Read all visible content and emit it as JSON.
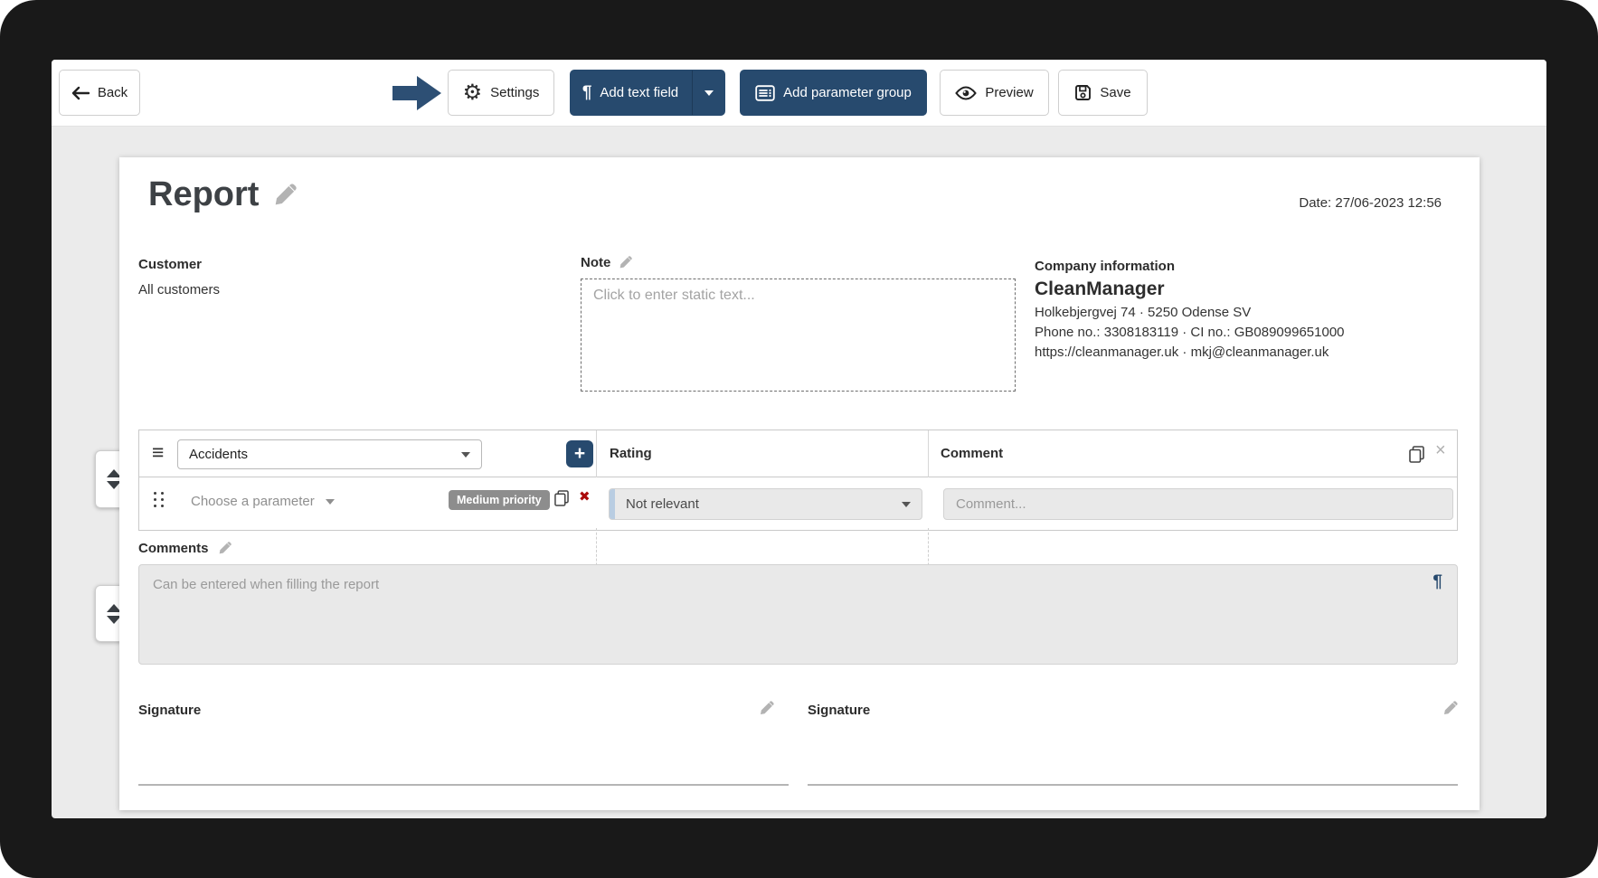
{
  "toolbar": {
    "back_label": "Back",
    "settings_label": "Settings",
    "add_text_field_label": "Add text field",
    "add_parameter_group_label": "Add parameter group",
    "preview_label": "Preview",
    "save_label": "Save"
  },
  "report": {
    "title": "Report",
    "date_text": "Date: 27/06-2023 12:56"
  },
  "customer": {
    "label": "Customer",
    "value": "All customers"
  },
  "note": {
    "label": "Note",
    "placeholder": "Click to enter static text..."
  },
  "company": {
    "label": "Company information",
    "name": "CleanManager",
    "address_line": "Holkebjergvej 74 · 5250 Odense SV",
    "phone_line": "Phone no.: 3308183119 · CI no.: GB089099651000",
    "web_line": "https://cleanmanager.uk · mkj@cleanmanager.uk"
  },
  "parameter_group": {
    "group_select_value": "Accidents",
    "columns": [
      "Rating",
      "Comment"
    ],
    "row": {
      "parameter_placeholder": "Choose a parameter",
      "priority_badge": "Medium priority",
      "rating_value": "Not relevant",
      "comment_placeholder": "Comment..."
    }
  },
  "comments": {
    "label": "Comments",
    "placeholder": "Can be entered when filling the report"
  },
  "signatures": [
    {
      "label": "Signature"
    },
    {
      "label": "Signature"
    }
  ],
  "icons": {
    "plus": "+",
    "pilcrow": "¶",
    "gear": "⚙",
    "hamburger": "≡",
    "red_x": "✖",
    "gray_x": "×"
  },
  "colors": {
    "navy": "#274a6e",
    "badge_gray": "#8d8d8d",
    "danger_red": "#ab0b0b",
    "body_gray": "#ebebeb"
  }
}
